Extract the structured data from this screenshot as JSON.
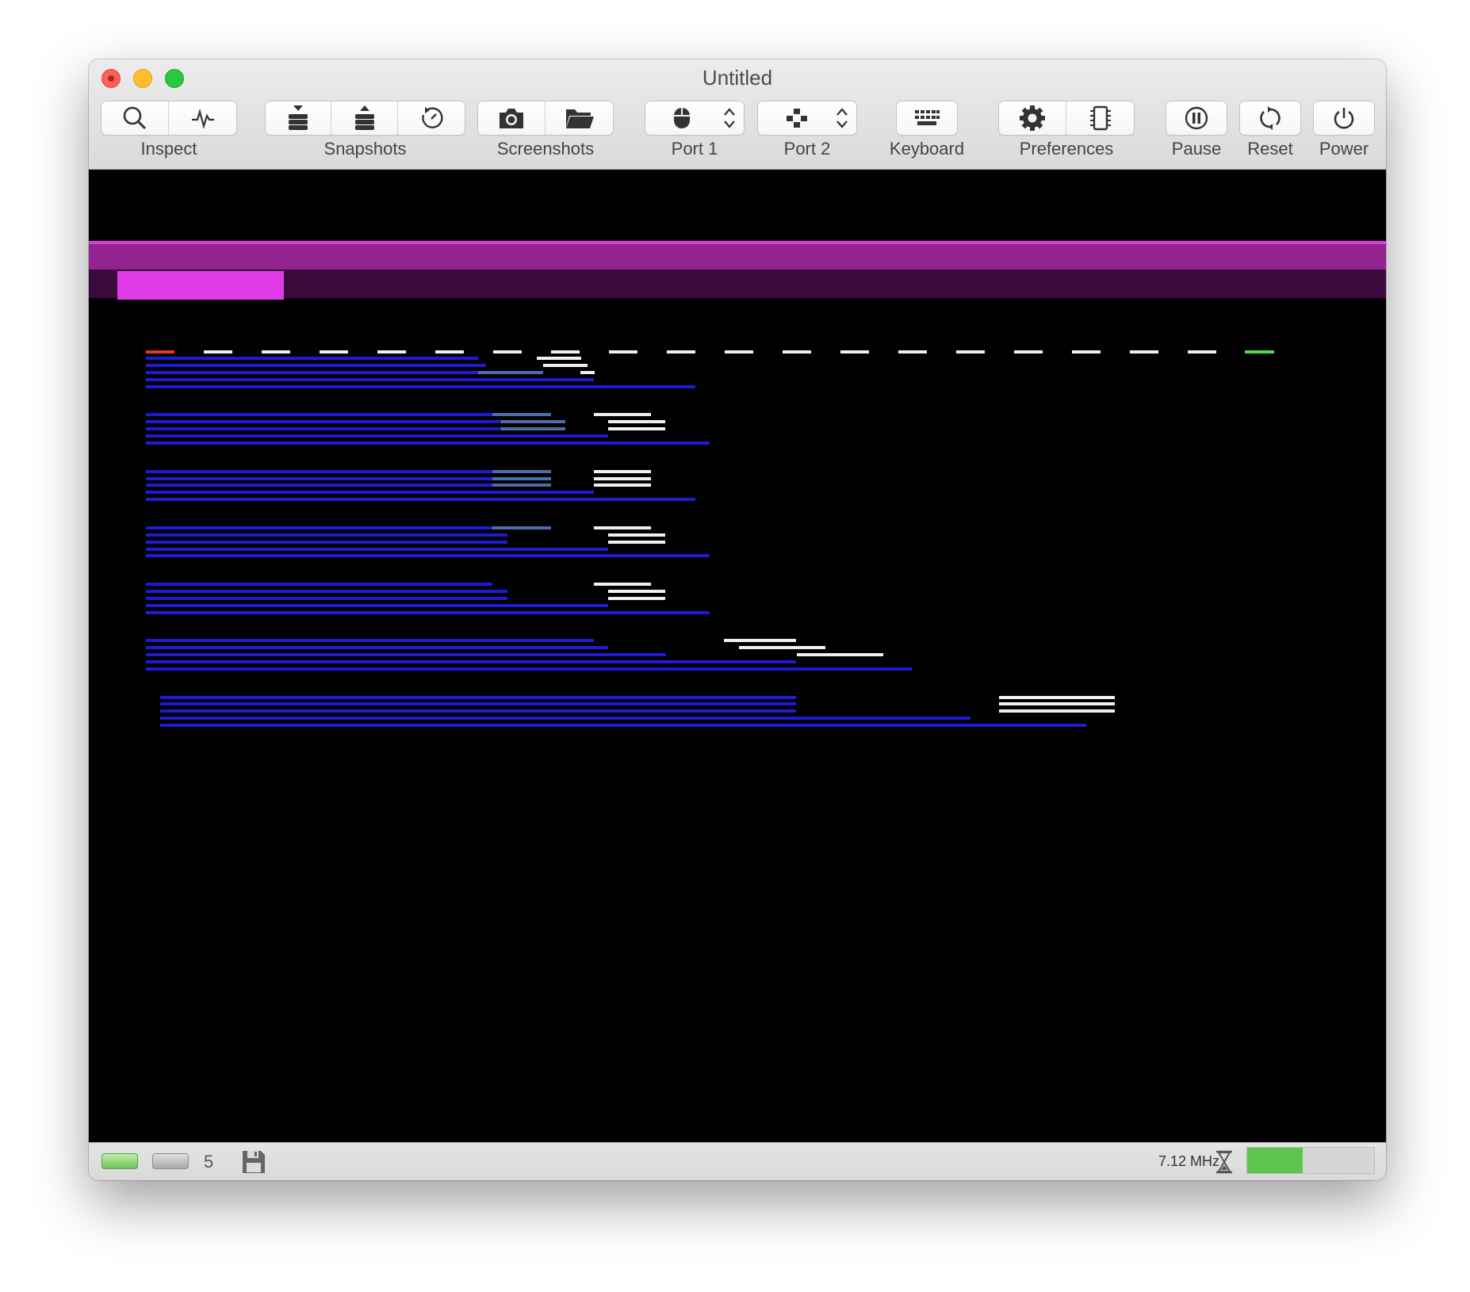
{
  "window": {
    "title": "Untitled"
  },
  "toolbar": {
    "inspect": "Inspect",
    "snapshots": "Snapshots",
    "screenshots": "Screenshots",
    "port1": "Port 1",
    "port2": "Port 2",
    "keyboard": "Keyboard",
    "preferences": "Preferences",
    "pause": "Pause",
    "reset": "Reset",
    "power": "Power"
  },
  "icons": {
    "inspect": [
      "magnifier-icon",
      "pulse-icon"
    ],
    "snapshots": [
      "snapshot-save-icon",
      "snapshot-restore-icon",
      "snapshot-timer-icon"
    ],
    "screenshots": [
      "camera-icon",
      "folder-icon"
    ],
    "port1": [
      "mouse-icon",
      "updown-chevron-icon"
    ],
    "port2": [
      "joystick-icon",
      "updown-chevron-icon"
    ],
    "keyboard": "keyboard-icon",
    "preferences": [
      "gear-icon",
      "chip-icon"
    ],
    "pause": "pause-icon",
    "reset": "reset-icon",
    "power": "power-icon"
  },
  "statusbar": {
    "drive_count": "5",
    "clock": "7.12 MHz",
    "speed_fraction": 0.44,
    "icons": [
      "drive-led-green",
      "drive-led-gray",
      "floppy-disk-icon",
      "hourglass-icon"
    ]
  },
  "colors": {
    "window_bg": "#e9e9e9",
    "screen_bg": "#000000",
    "magenta_bright": "#e03be6",
    "magenta_mid": "#93238f",
    "magenta_dark": "#3b0a3c",
    "raster_blue": "#1b1bd8",
    "raster_steel": "#4a6ea8",
    "raster_white": "#f0f0f0",
    "marker_red": "#e03a22",
    "marker_green": "#4ed94a",
    "speed_fill": "#5ec64e"
  }
}
